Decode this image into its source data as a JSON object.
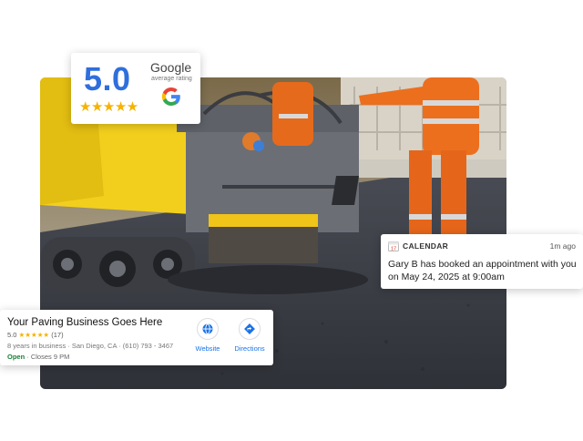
{
  "rating": {
    "score": "5.0",
    "stars": "★★★★★",
    "brand": "Google",
    "subtitle": "average rating",
    "logo_icon": "google-g-icon"
  },
  "calendar": {
    "app_name": "CALENDAR",
    "time_ago": "1m ago",
    "message": "Gary B has booked an appointment with you on May 24, 2025 at 9:00am",
    "icon": "calendar-icon",
    "icon_number": "17"
  },
  "business": {
    "name": "Your Paving Business Goes Here",
    "rating_value": "5.0",
    "rating_stars": "★★★★★",
    "review_count": "(17)",
    "meta": "8 years in business · San Diego, CA · (610) 793 - 3467",
    "open_status": "Open",
    "closes": " · Closes 9 PM",
    "actions": [
      {
        "label": "Website",
        "icon": "globe-icon"
      },
      {
        "label": "Directions",
        "icon": "directions-icon"
      }
    ],
    "accent_color": "#1a73e8"
  },
  "photo": {
    "subject": "paving-scene"
  }
}
